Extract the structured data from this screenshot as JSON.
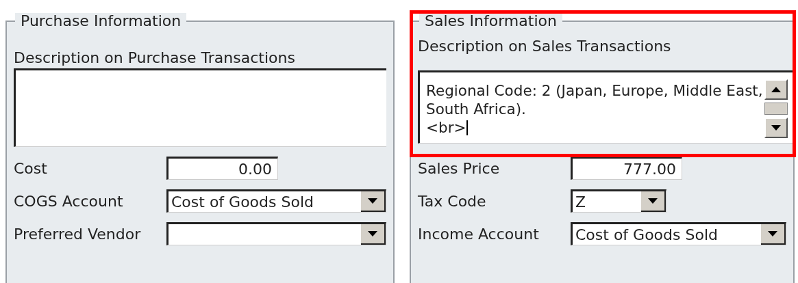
{
  "panels": [
    {
      "title": "Purchase Information",
      "highlighted": false,
      "description": {
        "label": "Description on Purchase Transactions",
        "scrollbar": false,
        "cursor": false
      },
      "fields": [
        {
          "label": "Cost",
          "kind": "number",
          "value": "0.00"
        },
        {
          "label": "COGS Account",
          "kind": "combo",
          "value": "Cost of Goods Sold"
        },
        {
          "label": "Preferred Vendor",
          "kind": "combo"
        }
      ]
    },
    {
      "title": "Sales Information",
      "highlighted": true,
      "description": {
        "label": "Description on Sales Transactions",
        "value": "Regional Code: 2 (Japan, Europe, Middle East, South Africa).\n<br>",
        "scrollbar": true,
        "cursor": true
      },
      "fields": [
        {
          "label": "Sales Price",
          "kind": "number",
          "value": "777.00"
        },
        {
          "label": "Tax Code",
          "kind": "short-combo",
          "value": "Z"
        },
        {
          "label": "Income Account",
          "kind": "combo",
          "value": "Cost of Goods Sold"
        }
      ]
    }
  ]
}
